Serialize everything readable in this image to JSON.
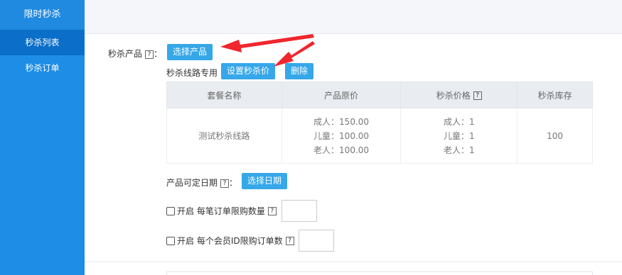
{
  "sidebar": {
    "title": "限时秒杀",
    "items": [
      {
        "label": "秒杀列表"
      },
      {
        "label": "秒杀订单"
      }
    ]
  },
  "form": {
    "product_label": "秒杀产品",
    "help_glyph": "?",
    "colon": "：",
    "select_product_button": "选择产品",
    "route_only_label": "秒杀线路专用",
    "set_price_button": "设置秒杀价",
    "delete_button": "删除",
    "date_label": "产品可定日期",
    "select_date_button": "选择日期",
    "enable_label": "开启",
    "per_order_limit_label": "每笔订单限购数量",
    "per_member_limit_label": "每个会员ID限购订单数",
    "per_order_limit_value": "",
    "per_member_limit_value": ""
  },
  "table": {
    "headers": [
      "套餐名称",
      "产品原价",
      "秒杀价格",
      "秒杀库存"
    ],
    "rows": [
      {
        "name": "测试秒杀线路",
        "original_prices": [
          "成人：150.00",
          "儿童：100.00",
          "老人：100.00"
        ],
        "seckill_prices": [
          "成人：1",
          "儿童：1",
          "老人：1"
        ],
        "stock": "100"
      }
    ]
  },
  "colors": {
    "sidebar_bg": "#1e8de5",
    "sidebar_active": "#0b6fc9",
    "button": "#36a7e8",
    "arrow": "#f0262e"
  }
}
